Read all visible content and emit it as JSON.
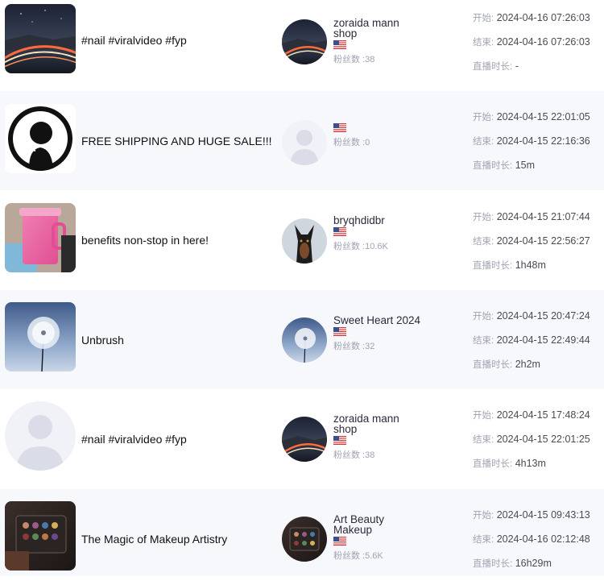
{
  "rows": [
    {
      "title": "#nail #viralvideo #fyp",
      "thumb_icon": "night-road-thumbnail",
      "anchor": {
        "name": "zoraida mann shop",
        "avatar_icon": "night-road-avatar",
        "flag_icon": "us-flag-icon",
        "fans": "粉丝数 :38"
      },
      "start_label": "开始:",
      "start": "2024-04-16 07:26:03",
      "end_label": "结束:",
      "end": "2024-04-16 07:26:03",
      "dur_label": "直播时长:",
      "duration": "-"
    },
    {
      "title": "FREE SHIPPING AND HUGE SALE!!!",
      "thumb_icon": "silhouette-thumbnail",
      "anchor": {
        "name": "",
        "avatar_icon": "placeholder-avatar",
        "flag_icon": "us-flag-icon",
        "fans": "粉丝数 :0"
      },
      "start_label": "开始:",
      "start": "2024-04-15 22:01:05",
      "end_label": "结束:",
      "end": "2024-04-15 22:16:36",
      "dur_label": "直播时长:",
      "duration": "15m"
    },
    {
      "title": "benefits non-stop in here!",
      "thumb_icon": "pink-tumbler-thumbnail",
      "anchor": {
        "name": "bryqhdidbr",
        "avatar_icon": "doberman-avatar",
        "flag_icon": "us-flag-icon",
        "fans": "粉丝数 :10.6K"
      },
      "start_label": "开始:",
      "start": "2024-04-15 21:07:44",
      "end_label": "结束:",
      "end": "2024-04-15 22:56:27",
      "dur_label": "直播时长:",
      "duration": "1h48m"
    },
    {
      "title": "Unbrush",
      "thumb_icon": "dandelion-thumbnail",
      "anchor": {
        "name": "Sweet Heart 2024",
        "avatar_icon": "dandelion-avatar",
        "flag_icon": "us-flag-icon",
        "fans": "粉丝数 :32"
      },
      "start_label": "开始:",
      "start": "2024-04-15 20:47:24",
      "end_label": "结束:",
      "end": "2024-04-15 22:49:44",
      "dur_label": "直播时长:",
      "duration": "2h2m"
    },
    {
      "title": "#nail #viralvideo #fyp",
      "thumb_icon": "placeholder-thumbnail",
      "anchor": {
        "name": "zoraida mann shop",
        "avatar_icon": "night-road-avatar",
        "flag_icon": "us-flag-icon",
        "fans": "粉丝数 :38"
      },
      "start_label": "开始:",
      "start": "2024-04-15 17:48:24",
      "end_label": "结束:",
      "end": "2024-04-15 22:01:25",
      "dur_label": "直播时长:",
      "duration": "4h13m"
    },
    {
      "title": "The Magic of Makeup Artistry",
      "thumb_icon": "makeup-palette-thumbnail",
      "anchor": {
        "name": "Art Beauty Makeup",
        "avatar_icon": "makeup-palette-avatar",
        "flag_icon": "us-flag-icon",
        "fans": "粉丝数 :5.6K"
      },
      "start_label": "开始:",
      "start": "2024-04-15 09:43:13",
      "end_label": "结束:",
      "end": "2024-04-16 02:12:48",
      "dur_label": "直播时长:",
      "duration": "16h29m"
    }
  ],
  "colors": {
    "row_alt_bg": "#f7f8fc",
    "muted_text": "#a0a4b2",
    "value_text": "#4a4a55"
  }
}
